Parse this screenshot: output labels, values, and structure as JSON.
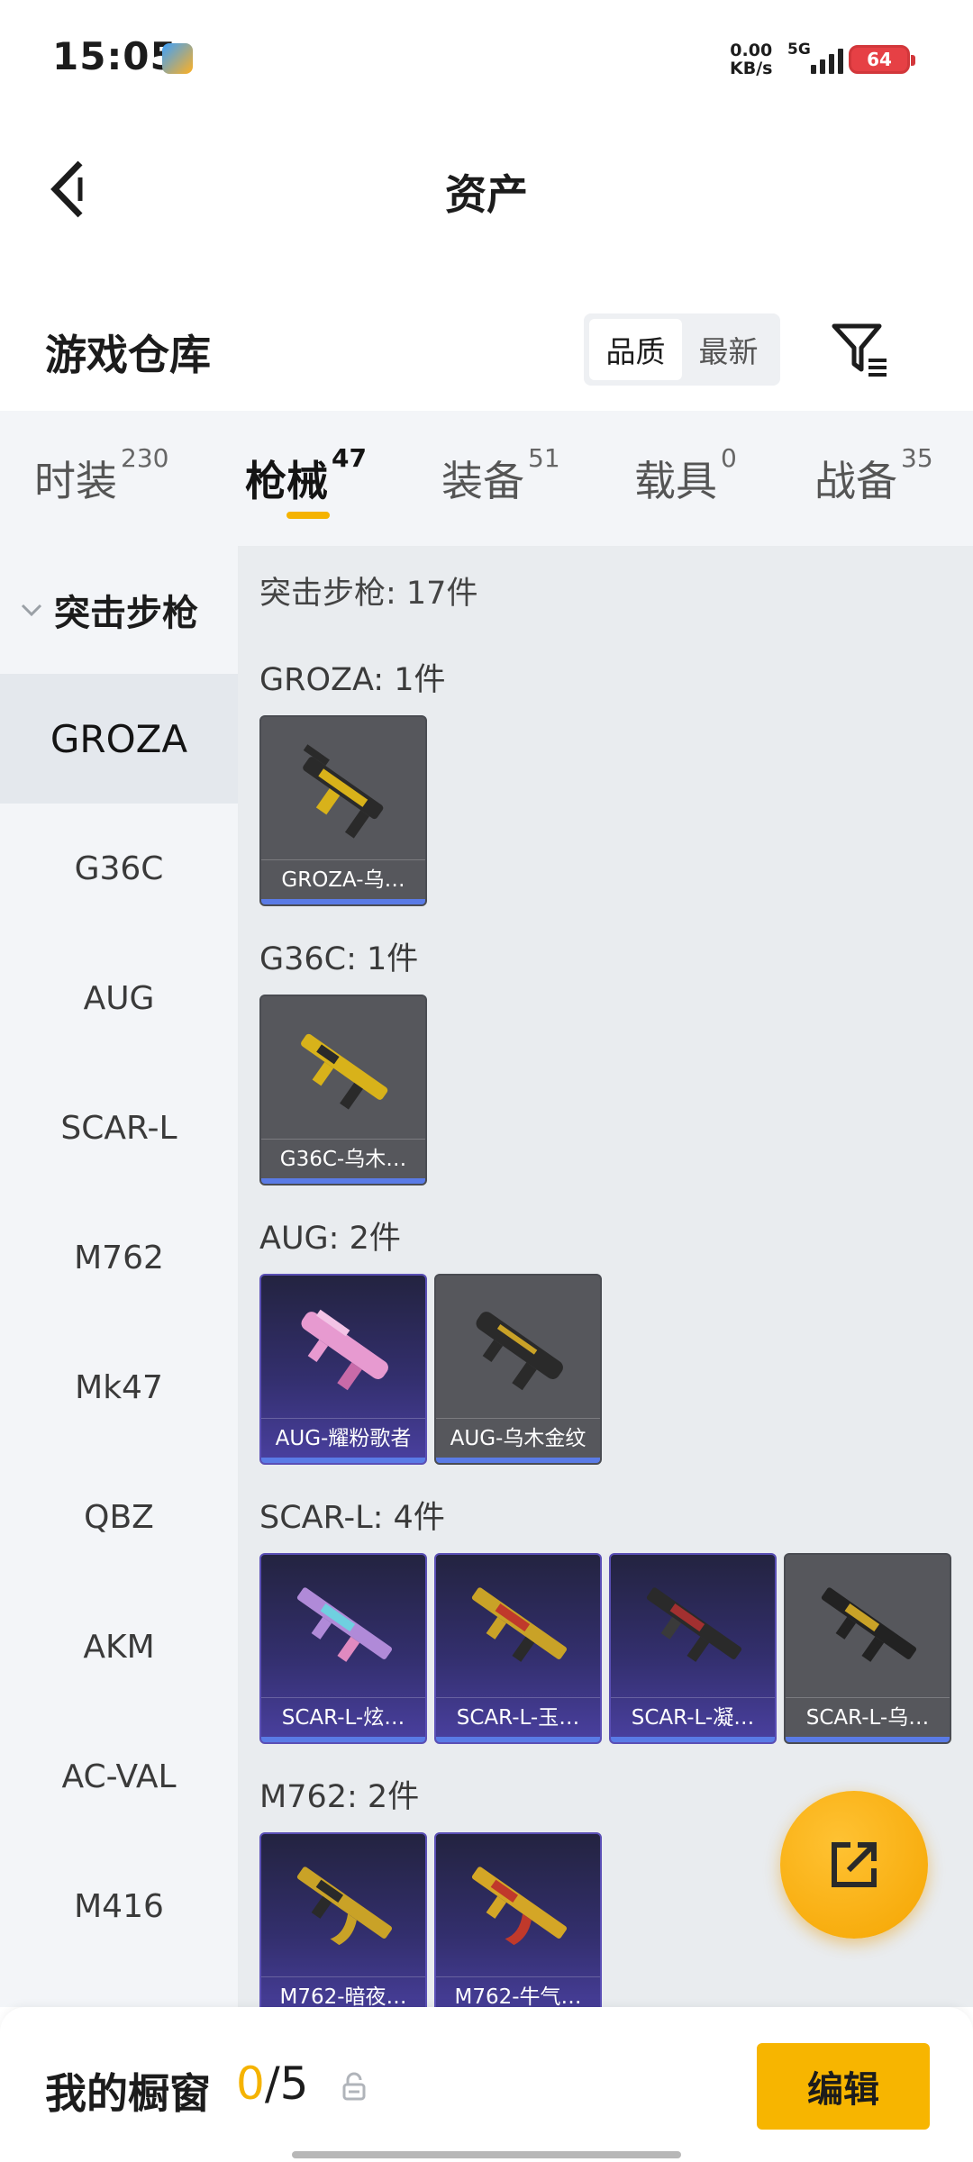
{
  "status_bar": {
    "time": "15:05",
    "speed_value": "0.00",
    "speed_unit": "KB/s",
    "network": "5G",
    "battery": "64"
  },
  "header": {
    "title": "资产"
  },
  "warehouse": {
    "title": "游戏仓库",
    "sort_options": [
      "品质",
      "最新"
    ],
    "sort_selected": "品质"
  },
  "tabs": [
    {
      "label": "时装",
      "count": "230"
    },
    {
      "label": "枪械",
      "count": "47"
    },
    {
      "label": "装备",
      "count": "51"
    },
    {
      "label": "载具",
      "count": "0"
    },
    {
      "label": "战备",
      "count": "35"
    }
  ],
  "sidebar": {
    "category": "突击步枪",
    "items": [
      "GROZA",
      "G36C",
      "AUG",
      "SCAR-L",
      "M762",
      "Mk47",
      "QBZ",
      "AKM",
      "AC-VAL",
      "M416"
    ],
    "selected": "GROZA"
  },
  "content": {
    "total_label": "突击步枪: 17件",
    "groups": [
      {
        "label": "GROZA: 1件",
        "items": [
          {
            "name": "GROZA-乌…",
            "rarity": "gray"
          }
        ]
      },
      {
        "label": "G36C: 1件",
        "items": [
          {
            "name": "G36C-乌木…",
            "rarity": "gray"
          }
        ]
      },
      {
        "label": "AUG: 2件",
        "items": [
          {
            "name": "AUG-耀粉歌者",
            "rarity": "purple"
          },
          {
            "name": "AUG-乌木金纹",
            "rarity": "gray"
          }
        ]
      },
      {
        "label": "SCAR-L: 4件",
        "items": [
          {
            "name": "SCAR-L-炫…",
            "rarity": "purple"
          },
          {
            "name": "SCAR-L-玉…",
            "rarity": "purple"
          },
          {
            "name": "SCAR-L-凝…",
            "rarity": "purple"
          },
          {
            "name": "SCAR-L-乌…",
            "rarity": "gray"
          }
        ]
      },
      {
        "label": "M762: 2件",
        "items": [
          {
            "name": "M762-暗夜…",
            "rarity": "purple"
          },
          {
            "name": "M762-牛气…",
            "rarity": "purple"
          }
        ]
      }
    ]
  },
  "bottom_bar": {
    "showcase_label": "我的橱窗",
    "showcase_used": "0",
    "showcase_total": "/5",
    "edit_label": "编辑"
  },
  "colors": {
    "accent": "#f5b301",
    "rarity_purple": "#4a40a0",
    "rarity_gray": "#56575c",
    "card_bar": "#5a7be6"
  },
  "icons": {
    "back": "chevron-left-icon",
    "filter": "filter-list-icon",
    "share": "share-external-icon",
    "lock": "lock-icon",
    "category_toggle": "chevron-down-icon"
  }
}
